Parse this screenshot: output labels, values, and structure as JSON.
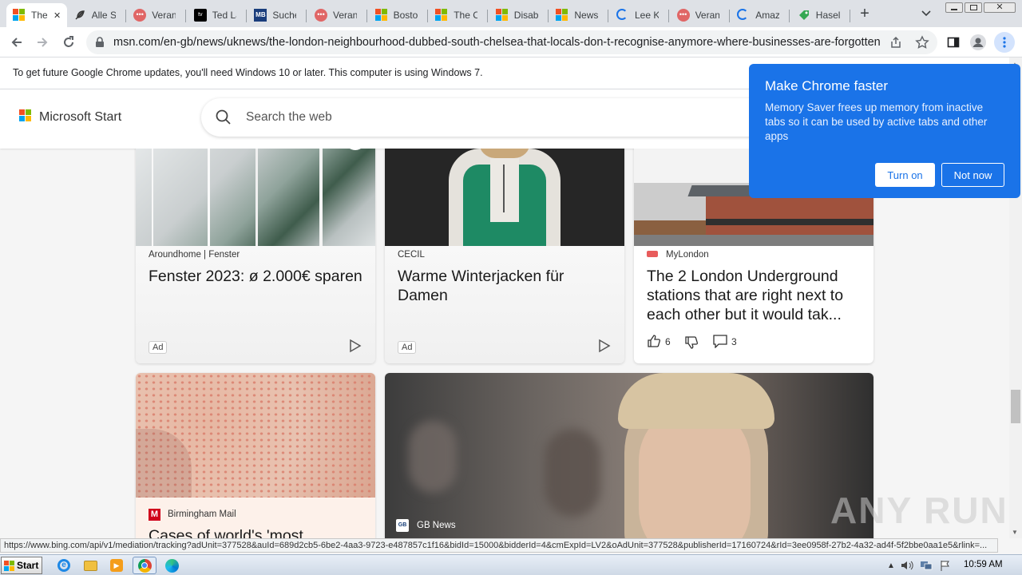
{
  "tabs": [
    {
      "label": "The",
      "icon": "microsoft-icon",
      "active": true
    },
    {
      "label": "Alle Str",
      "icon": "feather-icon"
    },
    {
      "label": "Veranst",
      "icon": "dots-icon"
    },
    {
      "label": "Ted Las",
      "icon": "appletv-icon"
    },
    {
      "label": "Sucher",
      "icon": "mb-icon"
    },
    {
      "label": "Veranst",
      "icon": "dots-icon"
    },
    {
      "label": "Boston",
      "icon": "microsoft-icon"
    },
    {
      "label": "The Cr",
      "icon": "microsoft-icon"
    },
    {
      "label": "Disable",
      "icon": "microsoft-icon"
    },
    {
      "label": "News r",
      "icon": "microsoft-icon"
    },
    {
      "label": "Lee Ku",
      "icon": "loading-icon"
    },
    {
      "label": "Veranst",
      "icon": "dots-icon"
    },
    {
      "label": "Amazor",
      "icon": "loading-icon"
    },
    {
      "label": "Haselh",
      "icon": "tag-icon"
    }
  ],
  "browser": {
    "url": "msn.com/en-gb/news/uknews/the-london-neighbourhood-dubbed-south-chelsea-that-locals-don-t-recognise-anymore-where-businesses-are-forgotten/ar-...",
    "new_tab": "+",
    "infobar_text": "To get future Google Chrome updates, you'll need Windows 10 or later. This computer is using Windows 7."
  },
  "msn": {
    "brand": "Microsoft Start",
    "search_placeholder": "Search the web"
  },
  "cards": [
    {
      "source": "Aroundhome | Fenster",
      "title": "Fenster 2023: ø 2.000€ sparen",
      "badge": "Ad"
    },
    {
      "source": "CECIL",
      "title": "Warme Winterjacken für Damen",
      "badge": "Ad"
    },
    {
      "source": "MyLondon",
      "title": "The 2 London Underground stations that are right next to each other but it would tak...",
      "likes": "6",
      "comments": "3"
    },
    {
      "source": "Birmingham Mail",
      "title": "Cases of world's 'most"
    },
    {
      "source": "GB News"
    }
  ],
  "popup": {
    "title": "Make Chrome faster",
    "body": "Memory Saver frees up memory from inactive tabs so it can be used by active tabs and other apps",
    "turn_on": "Turn on",
    "not_now": "Not now"
  },
  "status_url": "https://www.bing.com/api/v1/mediation/tracking?adUnit=377528&auId=689d2cb5-6be2-4aa3-9723-e487857c1f16&bidId=15000&bidderId=4&cmExpId=LV2&oAdUnit=377528&publisherId=17160724&rId=3ee0958f-27b2-4a32-ad4f-5f2bbe0aa1e5&rlink=...",
  "watermark": "ANY RUN",
  "taskbar": {
    "start": "Start",
    "clock": "10:59 AM"
  }
}
